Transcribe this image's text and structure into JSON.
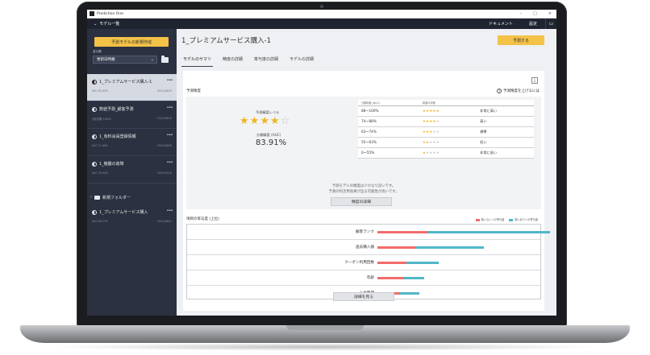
{
  "window": {
    "app_name": "Prediction One",
    "controls": [
      "–",
      "□",
      "×"
    ]
  },
  "topnav": {
    "model_list": "モデル一覧",
    "documents": "ドキュメント",
    "settings": "設定",
    "help_icon": "help-icon"
  },
  "sidebar": {
    "new_model_button": "予測モデルの新規作成",
    "sort_label": "並び順",
    "sort_value": "更新日時順",
    "models": [
      {
        "title": "1_プレミアムサービス購入-1",
        "meta_left": "AUC 83.91%",
        "meta_right": "2021/06/15"
      },
      {
        "title": "数値予測_顧客予測",
        "meta_left": "決定係数 0.83%",
        "meta_right": "2021/06/10"
      },
      {
        "title": "1_有料会員登録情報",
        "meta_left": "AUC 71.66%",
        "meta_right": "2021/06/09"
      },
      {
        "title": "1_機器の故障",
        "meta_left": "AUC 78.94%",
        "meta_right": "2021/05/10"
      }
    ],
    "folder": "新規フォルダー",
    "folder_model": {
      "title": "1_プレミアムサービス購入",
      "meta_left": "AUC 84.27%",
      "meta_right": "2021/06/01"
    }
  },
  "main": {
    "title": "1_プレミアムサービス購入-1",
    "predict_button": "予測する",
    "tabs": [
      "モデルのサマリ",
      "精度の詳細",
      "寄与度の詳細",
      "モデルの詳細"
    ],
    "accuracy": {
      "section_label": "予測精度",
      "improve_link": "予測精度を上げるには",
      "level_label": "予測精度レベル",
      "stars_filled": 4,
      "stars_total": 5,
      "auc_label": "分類精度 (AUC)",
      "auc_value": "83.91%",
      "table_headers": [
        "分類精度 (AUC)",
        "精度の評価"
      ],
      "table_rows": [
        {
          "range": "88～100%",
          "stars": 5,
          "label": "非常に高い"
        },
        {
          "range": "74～88%",
          "stars": 4,
          "label": "高い"
        },
        {
          "range": "63～74%",
          "stars": 3,
          "label": "標準"
        },
        {
          "range": "55～63%",
          "stars": 2,
          "label": "低い"
        },
        {
          "range": "0～55%",
          "stars": 1,
          "label": "非常に低い"
        }
      ],
      "note_line1": "予測モデルの精度は少かなり良いです。",
      "note_line2": "予測の利活用効果が出る可能性が高いです。",
      "detail_button": "精度の詳細"
    },
    "contribution": {
      "title": "項目の寄与度 (上位)",
      "legend_neg": "購入なしへの寄与度",
      "legend_pos": "購入ありへの寄与度",
      "color_neg": "#f26c6c",
      "color_pos": "#4fb7c9",
      "items": [
        {
          "label": "顧客ランク",
          "neg": 0.31,
          "pos": 0.76
        },
        {
          "label": "過去購入額",
          "neg": 0.24,
          "pos": 0.42
        },
        {
          "label": "クーポン利用回数",
          "neg": 0.18,
          "pos": 0.2
        },
        {
          "label": "年齢",
          "neg": 0.16,
          "pos": 0.13
        },
        {
          "label": "入会時期",
          "neg": 0.14,
          "pos": 0.12
        }
      ],
      "detail_button": "詳細を見る"
    }
  }
}
